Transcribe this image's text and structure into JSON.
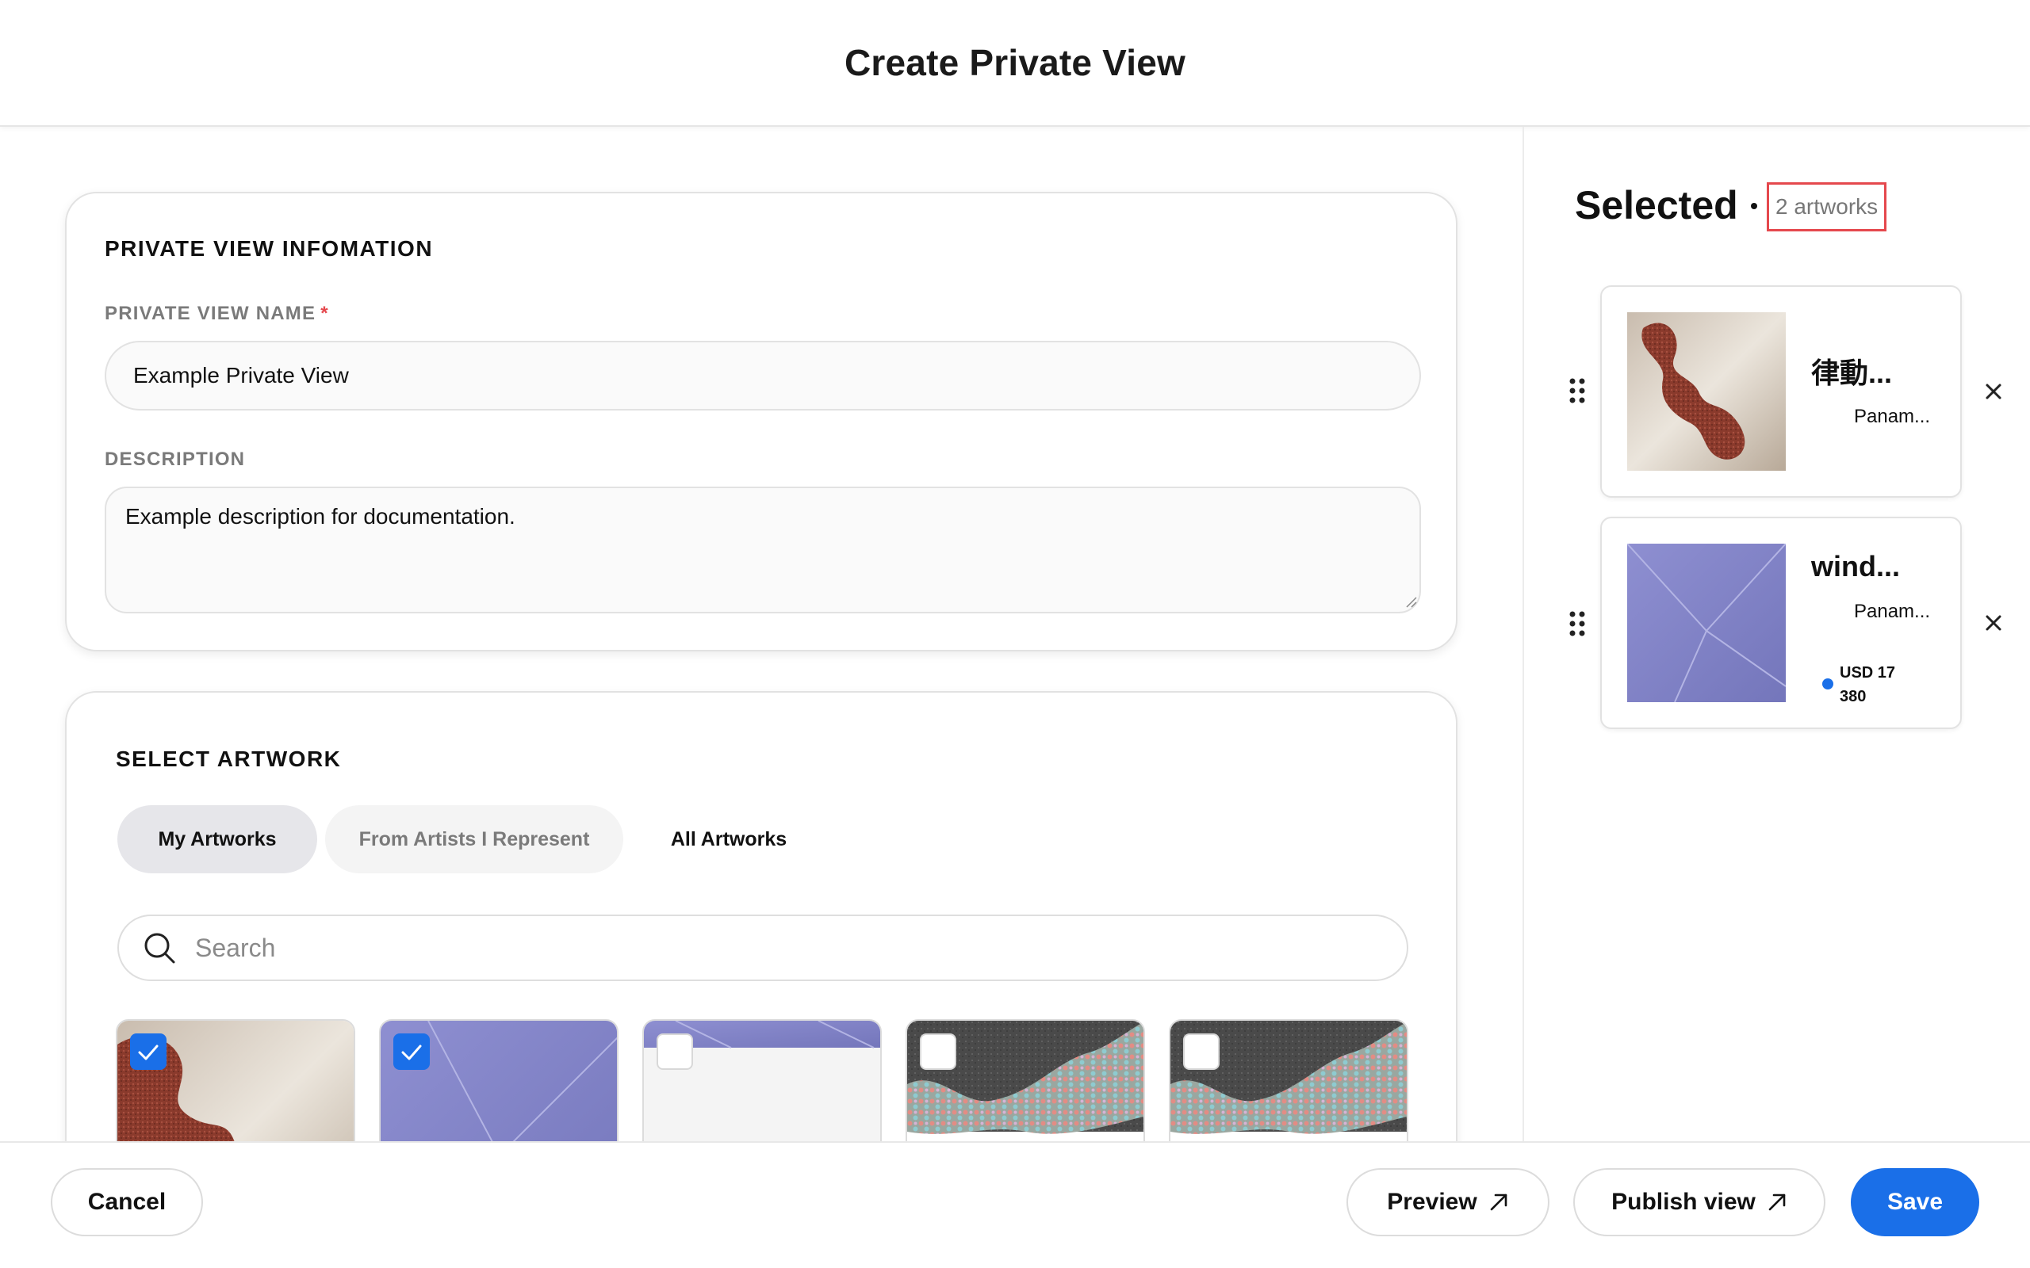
{
  "header": {
    "title": "Create Private View"
  },
  "info": {
    "section_title": "PRIVATE VIEW INFOMATION",
    "name_label": "PRIVATE VIEW NAME",
    "required_mark": "*",
    "name_value": "Example Private View",
    "description_label": "DESCRIPTION",
    "description_value": "Example description for documentation."
  },
  "artwork": {
    "section_title": "SELECT ARTWORK",
    "tabs": [
      {
        "label": "My Artworks",
        "active": true
      },
      {
        "label": "From Artists I Represent",
        "active": false
      },
      {
        "label": "All Artworks",
        "active": false
      }
    ],
    "search_placeholder": "Search",
    "thumbnails": [
      {
        "checked": true,
        "image": "red-sculpture"
      },
      {
        "checked": true,
        "image": "purple-fabric"
      },
      {
        "checked": false,
        "image": "purple-fabric-blank"
      },
      {
        "checked": false,
        "image": "dark-dotted-pattern"
      },
      {
        "checked": false,
        "image": "dark-dotted-pattern"
      }
    ]
  },
  "selected": {
    "title": "Selected",
    "count": "2 artworks",
    "items": [
      {
        "name": "律動...",
        "artist": "Panam...",
        "image": "red-sculpture"
      },
      {
        "name": "wind...",
        "artist": "Panam...",
        "price_line1": "USD 17",
        "price_line2": "380",
        "image": "purple-fabric"
      }
    ]
  },
  "footer": {
    "cancel": "Cancel",
    "preview": "Preview",
    "publish": "Publish view",
    "save": "Save"
  },
  "colors": {
    "accent": "#1a6fe8",
    "required": "#e5484d",
    "highlight_box": "#e5484d"
  },
  "icons": [
    "search-icon",
    "check-icon",
    "drag-handle-icon",
    "close-icon",
    "external-arrow-icon",
    "resize-grip-icon"
  ]
}
